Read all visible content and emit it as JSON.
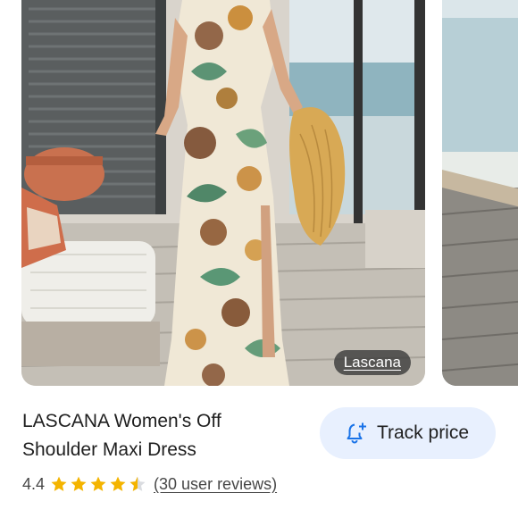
{
  "carousel": {
    "main_image": {
      "brand_label": "Lascana"
    }
  },
  "product": {
    "title_line1": "LASCANA Women's Off",
    "title_line2": "Shoulder Maxi Dress",
    "rating": "4.4",
    "star_value": 4.5,
    "reviews_label": "(30 user reviews)"
  },
  "track_price": {
    "label": "Track price",
    "icon": "bell-plus-icon"
  },
  "colors": {
    "star": "#f4b400",
    "track_bg": "#e8f0fe",
    "track_icon": "#1a73e8"
  }
}
